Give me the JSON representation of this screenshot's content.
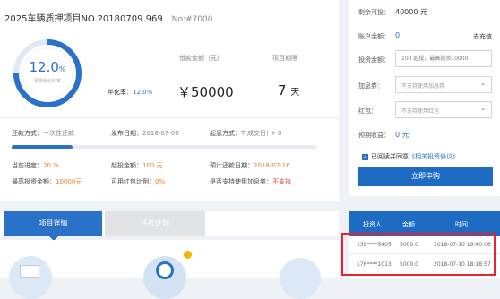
{
  "project": {
    "title": "2025车辆质押项目NO.20180709.969",
    "number": "No:#7000",
    "rate_value": "12.0",
    "rate_unit": "%",
    "rate_label": "预期年化利率",
    "rate_fraction": 0.75,
    "annual_prefix": "年化率：",
    "annual_value": "12.0%",
    "amount_label": "借款金额（元）",
    "amount_value": "￥50000",
    "term_label": "项目期限",
    "term_value": "7",
    "term_unit": "天"
  },
  "details": {
    "repay_label": "还款方式：",
    "repay_value": "一次性还款",
    "publish_label": "发布日期：",
    "publish_value": "2018-07-09",
    "interest_label": "起息方式：",
    "interest_value": "T(成交日) + 0",
    "progress_fraction": 0.2,
    "progress_label": "当前进度：",
    "progress_value": "20 %",
    "min_label": "起投金额：",
    "min_value": "100 元",
    "repay_date_label": "预计还款日期：",
    "repay_date_value": "2018-07-16",
    "max_label": "最高投资金额：",
    "max_value": "10000元",
    "coupon_ratio_label": "可用红包比例：",
    "coupon_ratio_value": "0%",
    "addrate_label": "是否支持使用加息券：",
    "addrate_value": "不支持"
  },
  "invest": {
    "remaining_label": "剩余可投：",
    "remaining_value": "40000 元",
    "balance_label": "账户余额：",
    "balance_value": "0",
    "recharge_label": "去充值",
    "amount_label": "投资金额：",
    "amount_placeholder": "100 起投，最高投资10000",
    "coupon_label": "加息券：",
    "coupon_value": "不支持使用加息券",
    "redpack_label": "红包：",
    "redpack_value": "不支持使用红包",
    "expected_label": "预期收益：",
    "expected_value": "0 元",
    "agree_text": "已阅读并同意",
    "agree_link": "《相关投资协议》",
    "buy_label": "立即申购"
  },
  "tabs": {
    "details": "项目详情",
    "plan": "还款计划"
  },
  "records": {
    "headers": [
      "投资人",
      "金额",
      "时间"
    ],
    "rows": [
      {
        "investor": "139****5405",
        "amount": "5000.0",
        "time": "2018-07-10 19:40:06"
      },
      {
        "investor": "176****1013",
        "amount": "5000.0",
        "time": "2018-07-10 18:18:57"
      }
    ]
  },
  "colors": {
    "accent": "#2a71c8",
    "orange": "#f07c27",
    "highlight_box": "#e8232f"
  },
  "icons": [
    "check-icon",
    "chevron-down-icon",
    "document-icon",
    "stopwatch-icon",
    "coins-icon"
  ]
}
